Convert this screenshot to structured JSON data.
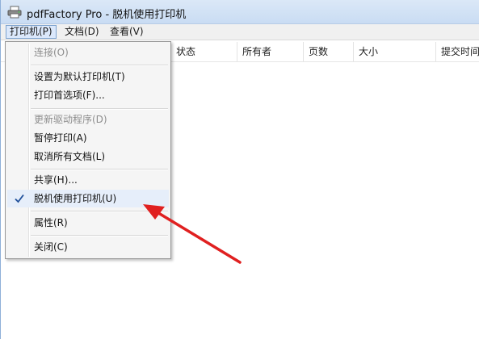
{
  "window": {
    "title": "pdfFactory Pro  -  脱机使用打印机"
  },
  "menubar": {
    "printer": "打印机(P)",
    "document": "文档(D)",
    "view": "查看(V)"
  },
  "columns": [
    "状态",
    "所有者",
    "页数",
    "大小",
    "提交时间"
  ],
  "printer_menu": {
    "connect": "连接(O)",
    "set_default": "设置为默认打印机(T)",
    "preferences": "打印首选项(F)...",
    "update_driver": "更新驱动程序(D)",
    "pause": "暂停打印(A)",
    "cancel_all": "取消所有文档(L)",
    "share": "共享(H)...",
    "use_offline": "脱机使用打印机(U)",
    "properties": "属性(R)",
    "close": "关闭(C)"
  },
  "icons": {
    "app": "printer-icon",
    "check": "check-icon"
  },
  "colors": {
    "annotation_arrow": "#e02020",
    "menu_highlight": "#dbe8fb"
  }
}
